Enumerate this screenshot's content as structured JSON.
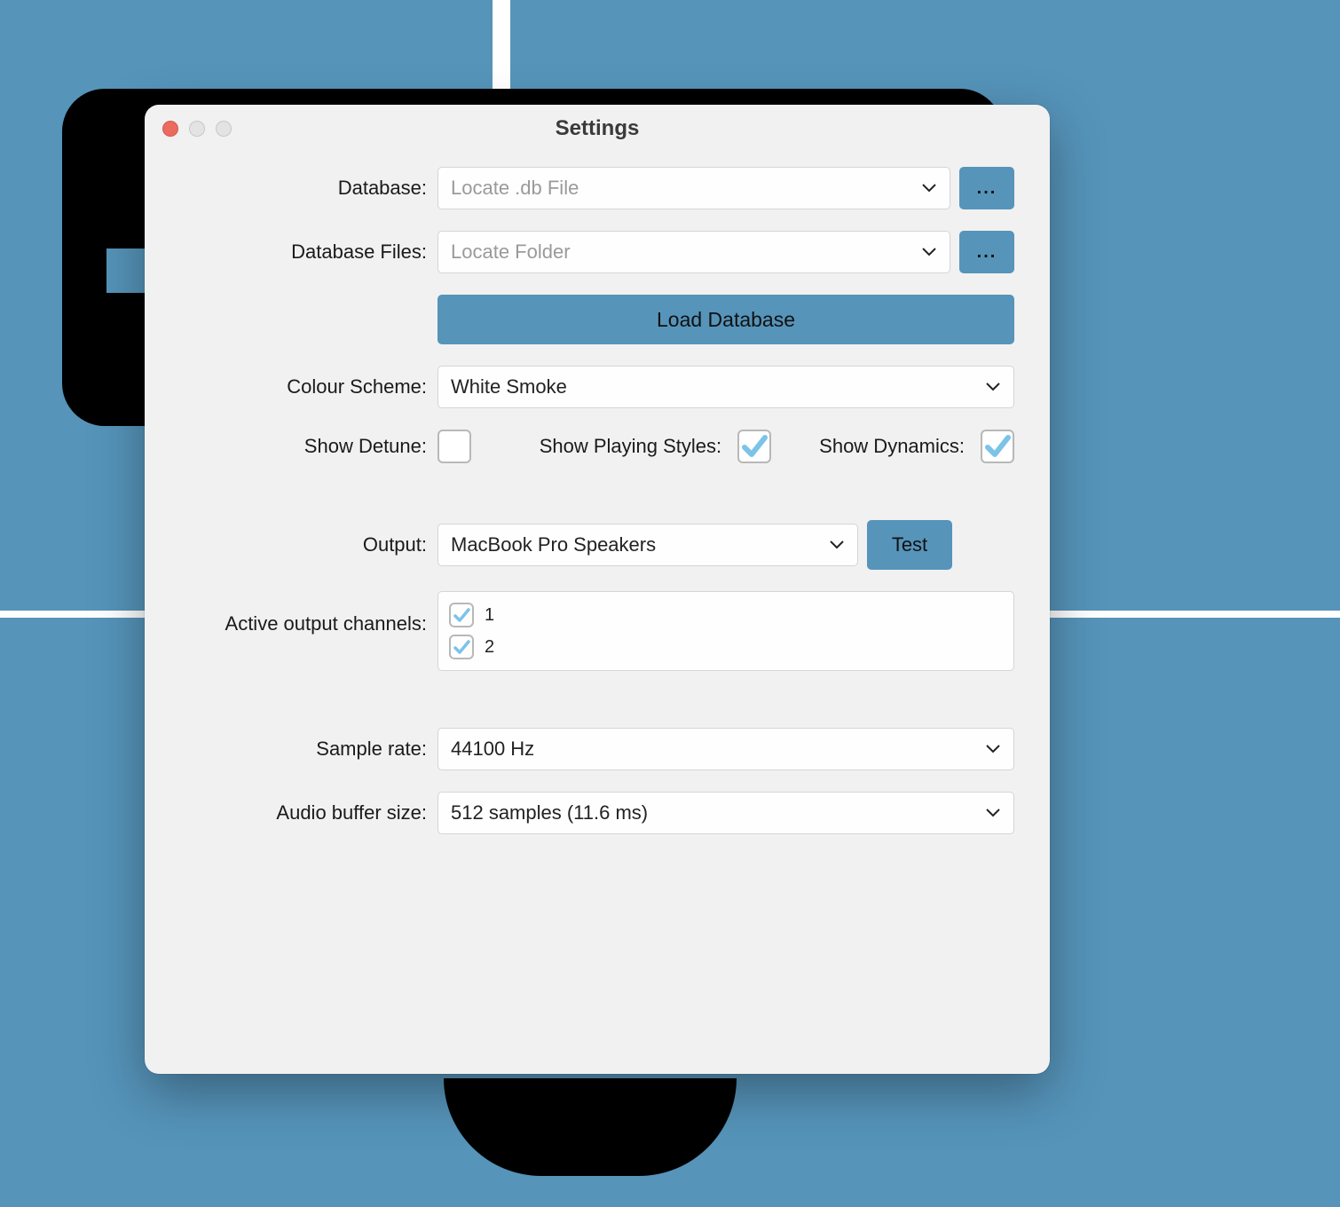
{
  "window": {
    "title": "Settings"
  },
  "labels": {
    "database": "Database:",
    "database_files": "Database Files:",
    "colour_scheme": "Colour Scheme:",
    "show_detune": "Show Detune:",
    "show_playing_styles": "Show Playing Styles:",
    "show_dynamics": "Show Dynamics:",
    "output": "Output:",
    "active_channels": "Active output channels:",
    "sample_rate": "Sample rate:",
    "buffer_size": "Audio buffer size:"
  },
  "fields": {
    "database_placeholder": "Locate .db File",
    "database_files_placeholder": "Locate Folder",
    "browse_label": "...",
    "load_db_label": "Load Database",
    "colour_scheme_value": "White Smoke",
    "output_value": "MacBook Pro Speakers",
    "test_label": "Test",
    "sample_rate_value": "44100 Hz",
    "buffer_size_value": "512 samples (11.6 ms)"
  },
  "toggles": {
    "show_detune": false,
    "show_playing_styles": true,
    "show_dynamics": true
  },
  "channels": [
    {
      "label": "1",
      "checked": true
    },
    {
      "label": "2",
      "checked": true
    }
  ],
  "colors": {
    "accent": "#5694ba"
  }
}
